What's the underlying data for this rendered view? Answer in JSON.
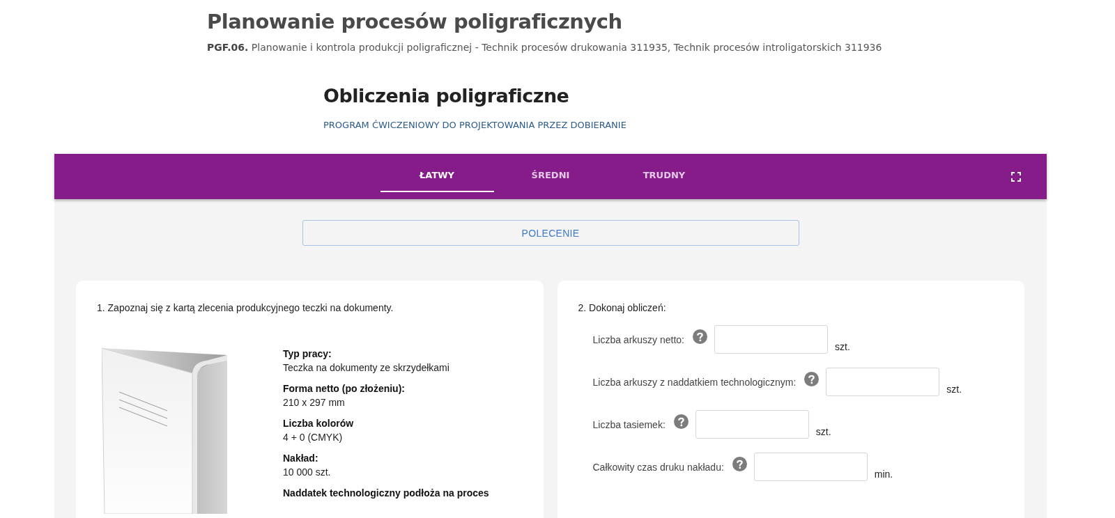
{
  "header": {
    "title": "Planowanie procesów poligraficznych",
    "course_code": "PGF.06.",
    "course_text": "Planowanie i kontrola produkcji poligraficznej - Technik procesów drukowania 311935, Technik procesów introligatorskich 311936"
  },
  "app": {
    "title": "Obliczenia poligraficzne",
    "subtitle": "PROGRAM ĆWICZENIOWY DO PROJEKTOWANIA PRZEZ DOBIERANIE"
  },
  "tabs": [
    {
      "label": "ŁATWY",
      "selected": true
    },
    {
      "label": "ŚREDNI",
      "selected": false
    },
    {
      "label": "TRUDNY",
      "selected": false
    }
  ],
  "instruction_button": "POLECENIE",
  "order_card": {
    "heading": "1. Zapoznaj się z kartą zlecenia produkcyjnego teczki na dokumenty.",
    "details": [
      {
        "label": "Typ pracy:",
        "value": "Teczka na dokumenty ze skrzydełkami"
      },
      {
        "label": "Forma netto (po złożeniu):",
        "value": "210 x 297 mm"
      },
      {
        "label": "Liczba kolorów",
        "value": "4 + 0 (CMYK)"
      },
      {
        "label": "Nakład:",
        "value": "10 000 szt."
      },
      {
        "label": "Naddatek technologiczny podłoża na proces"
      }
    ]
  },
  "calc_card": {
    "heading": "2. Dokonaj obliczeń:",
    "fields": [
      {
        "label": "Liczba arkuszy netto:",
        "unit": "szt."
      },
      {
        "label": "Liczba arkuszy z naddatkiem technologicznym:",
        "unit": "szt."
      },
      {
        "label": "Liczba tasiemek:",
        "unit": "szt."
      },
      {
        "label": "Całkowity czas druku nakładu:",
        "unit": "min."
      }
    ]
  }
}
